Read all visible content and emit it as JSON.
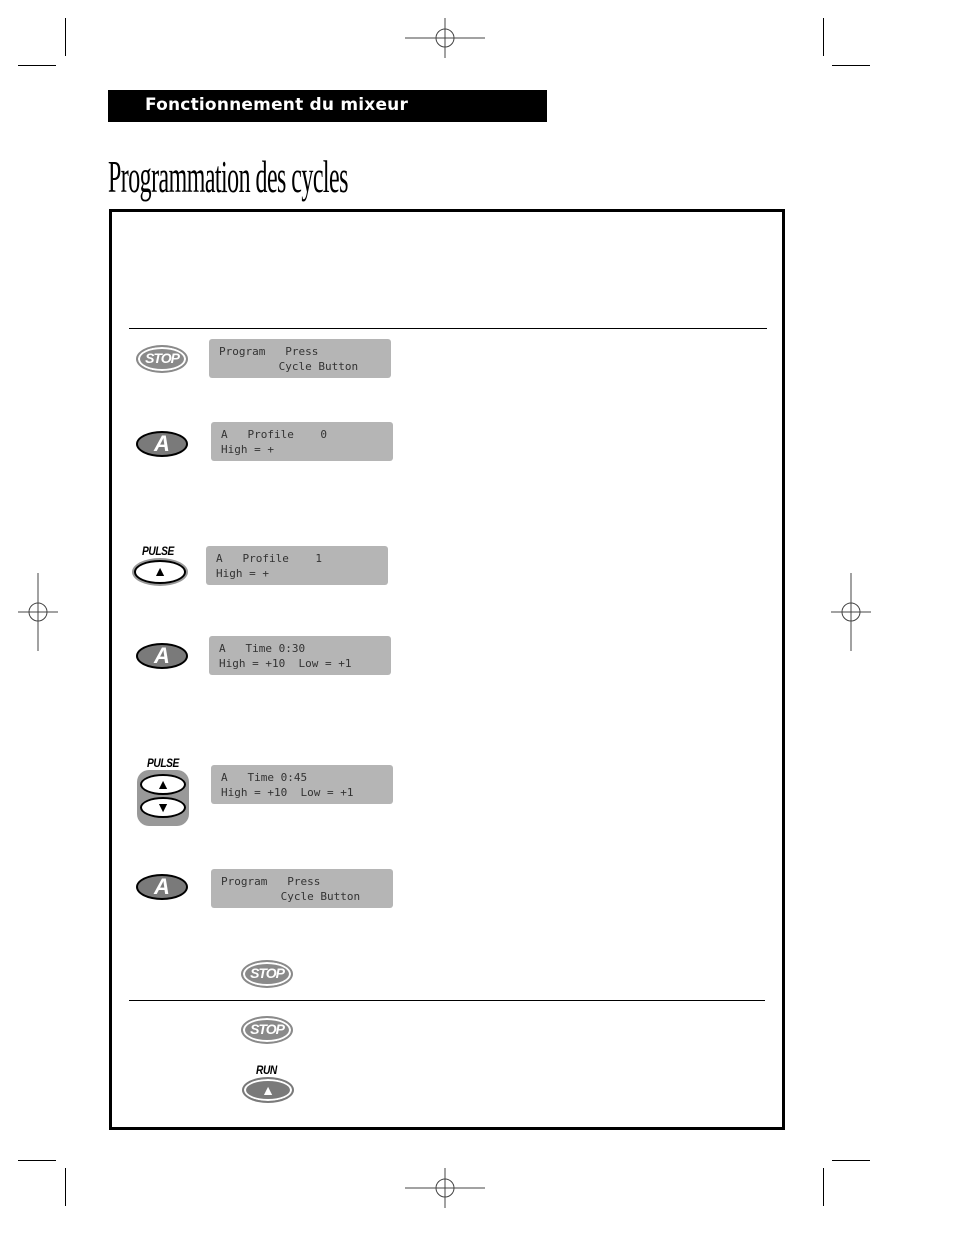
{
  "header": {
    "section_label": "Fonctionnement du mixeur"
  },
  "title": "Programmation des cycles",
  "steps": [
    {
      "button": "stop-icon",
      "button_label": "STOP",
      "display": [
        "Program   Press",
        "         Cycle Button"
      ]
    },
    {
      "button": "a-icon",
      "button_label": "A",
      "display": [
        "A   Profile    0",
        "High = +"
      ]
    },
    {
      "button": "pulse-up-icon",
      "button_label": "PULSE",
      "display": [
        "A   Profile    1",
        "High = +"
      ]
    },
    {
      "button": "a-icon",
      "button_label": "A",
      "display": [
        "A   Time 0:30",
        "High = +10  Low = +1"
      ]
    },
    {
      "button": "pulse-updown-icon",
      "button_label": "PULSE",
      "display": [
        "A   Time 0:45",
        "High = +10  Low = +1"
      ]
    },
    {
      "button": "a-icon",
      "button_label": "A",
      "display": [
        "Program   Press",
        "         Cycle Button"
      ]
    }
  ],
  "final": {
    "stop1_label": "STOP",
    "stop2_label": "STOP",
    "run_label": "RUN"
  },
  "glyphs": {
    "up": "▲",
    "down": "▼"
  }
}
